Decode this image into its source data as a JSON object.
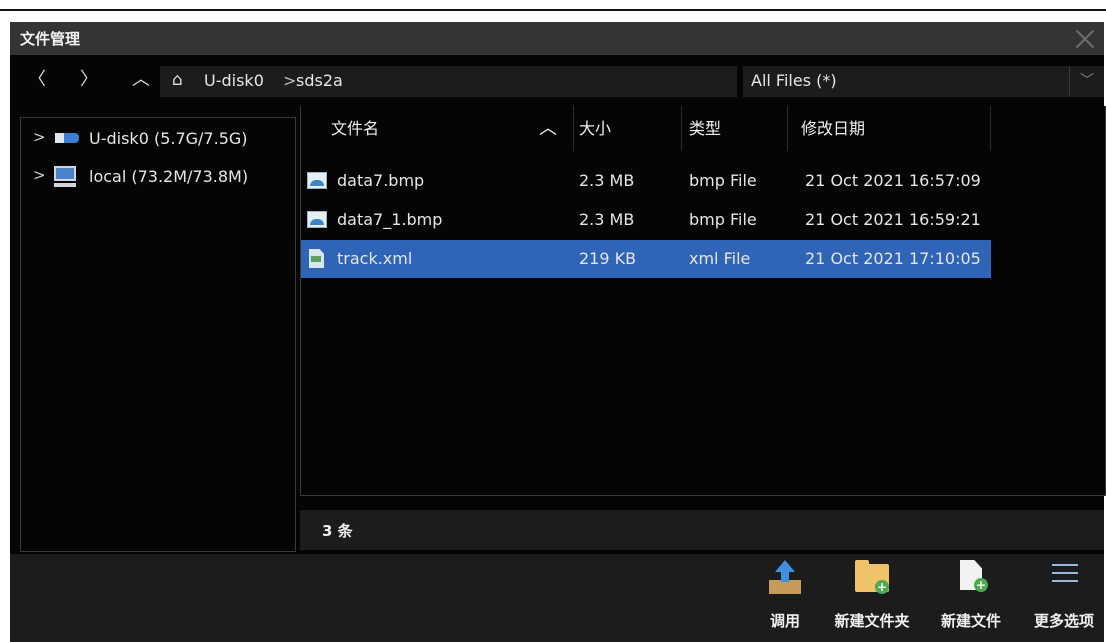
{
  "window": {
    "title": "文件管理"
  },
  "nav": {
    "back_icon": "chevron-left",
    "forward_icon": "chevron-right",
    "up_icon": "chevron-up",
    "home_icon": "home",
    "breadcrumb": [
      "U-disk0",
      "sds2a"
    ],
    "separator": ">"
  },
  "filter": {
    "selected": "All Files (*)"
  },
  "tree": {
    "items": [
      {
        "label": "U-disk0  (5.7G/7.5G)",
        "icon": "usb-drive"
      },
      {
        "label": "local  (73.2M/73.8M)",
        "icon": "computer"
      }
    ]
  },
  "files": {
    "columns": {
      "name": "文件名",
      "size": "大小",
      "type": "类型",
      "modified": "修改日期"
    },
    "sort_icon": "chevron-up",
    "rows": [
      {
        "name": "data7.bmp",
        "size": "2.3 MB",
        "type": "bmp File",
        "modified": "21 Oct 2021 16:57:09",
        "icon": "image-file"
      },
      {
        "name": "data7_1.bmp",
        "size": "2.3 MB",
        "type": "bmp File",
        "modified": "21 Oct 2021 16:59:21",
        "icon": "image-file"
      },
      {
        "name": "track.xml",
        "size": "219 KB",
        "type": "xml File",
        "modified": "21 Oct 2021 17:10:05",
        "icon": "xml-file",
        "selected": true
      }
    ]
  },
  "status": {
    "count": "3 条"
  },
  "toolbar": {
    "load": "调用",
    "new_folder": "新建文件夹",
    "new_file": "新建文件",
    "more": "更多选项"
  },
  "colors": {
    "selected_row": "#2f64b6",
    "background": "#050505",
    "panel": "#1c1c1c"
  }
}
